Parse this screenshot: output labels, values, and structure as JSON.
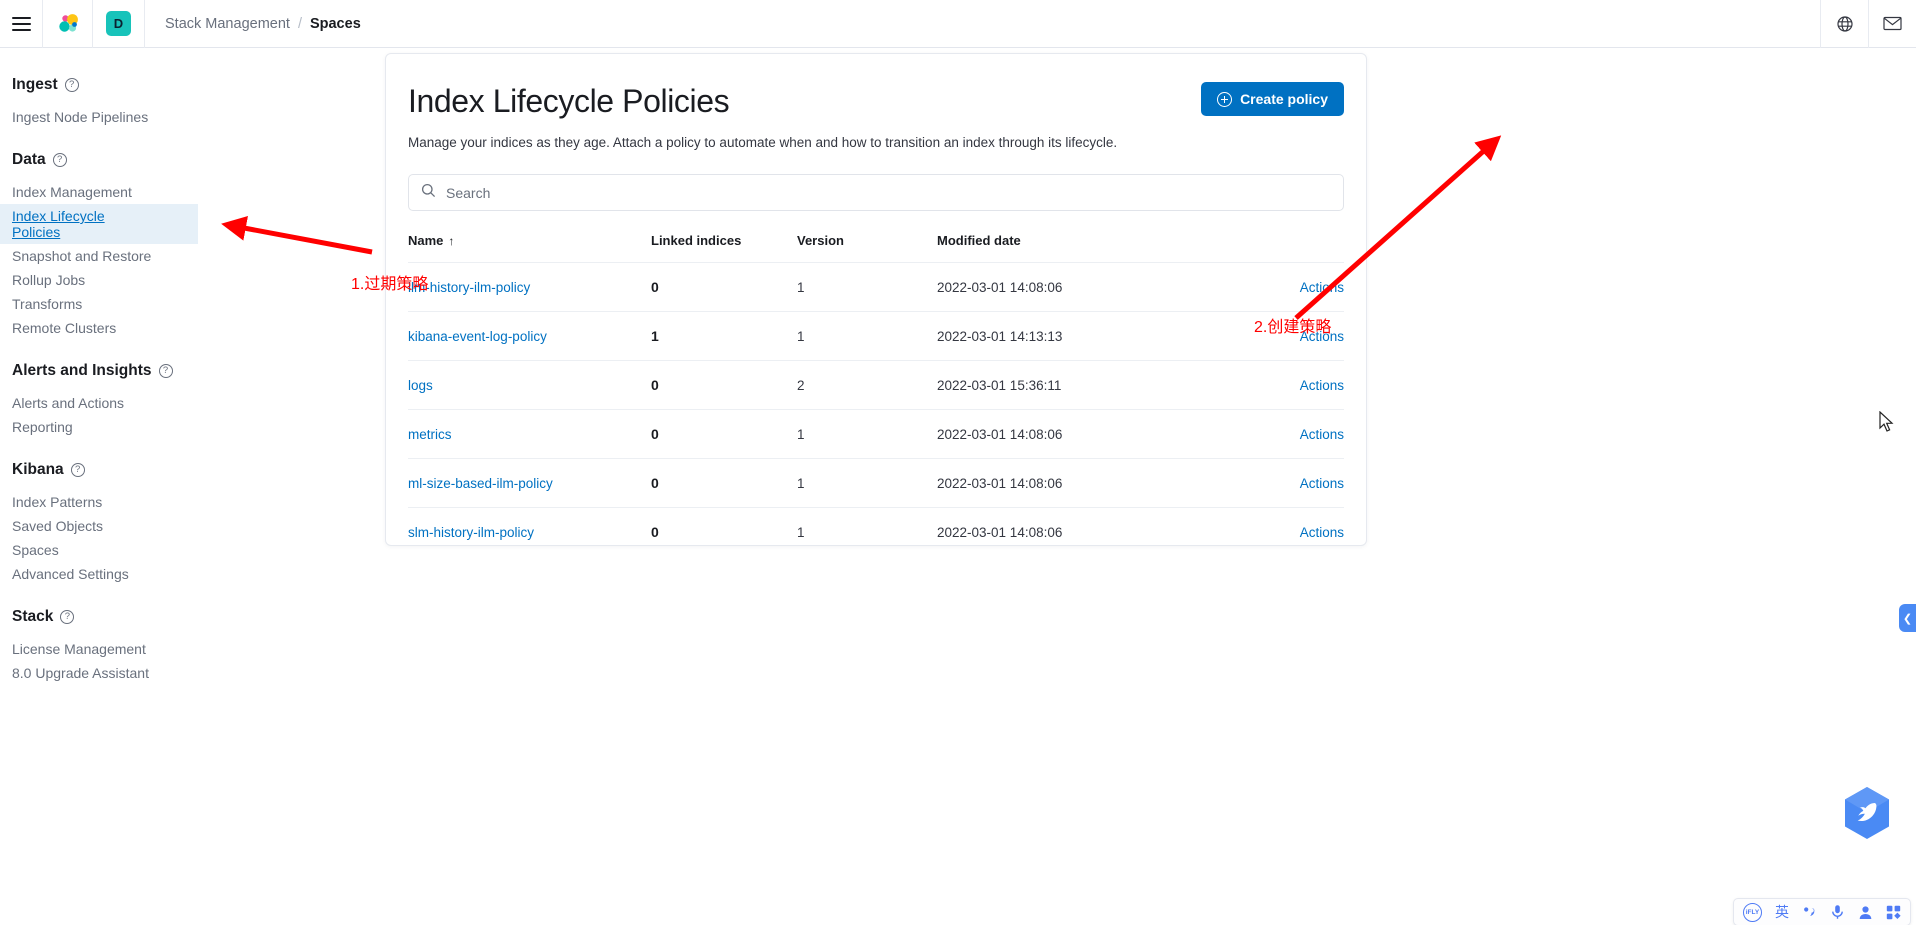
{
  "header": {
    "menu_icon": "hamburger-menu-icon",
    "logo_icon": "elastic-logo-icon",
    "space_avatar_letter": "D",
    "breadcrumbs": [
      {
        "label": "Stack Management",
        "active": false
      },
      {
        "label": "Spaces",
        "active": true
      }
    ],
    "separator": "/",
    "right_icons": [
      {
        "name": "help-globe-icon"
      },
      {
        "name": "mail-icon"
      }
    ]
  },
  "sidebar": {
    "groups": [
      {
        "title": "Ingest",
        "help_icon": "question-mark-icon",
        "items": [
          {
            "label": "Ingest Node Pipelines",
            "selected": false
          }
        ]
      },
      {
        "title": "Data",
        "help_icon": "question-mark-icon",
        "items": [
          {
            "label": "Index Management",
            "selected": false
          },
          {
            "label": "Index Lifecycle Policies",
            "selected": true
          },
          {
            "label": "Snapshot and Restore",
            "selected": false
          },
          {
            "label": "Rollup Jobs",
            "selected": false
          },
          {
            "label": "Transforms",
            "selected": false
          },
          {
            "label": "Remote Clusters",
            "selected": false
          }
        ]
      },
      {
        "title": "Alerts and Insights",
        "help_icon": "question-mark-icon",
        "items": [
          {
            "label": "Alerts and Actions",
            "selected": false
          },
          {
            "label": "Reporting",
            "selected": false
          }
        ]
      },
      {
        "title": "Kibana",
        "help_icon": "question-mark-icon",
        "items": [
          {
            "label": "Index Patterns",
            "selected": false
          },
          {
            "label": "Saved Objects",
            "selected": false
          },
          {
            "label": "Spaces",
            "selected": false
          },
          {
            "label": "Advanced Settings",
            "selected": false
          }
        ]
      },
      {
        "title": "Stack",
        "help_icon": "question-mark-icon",
        "items": [
          {
            "label": "License Management",
            "selected": false
          },
          {
            "label": "8.0 Upgrade Assistant",
            "selected": false
          }
        ]
      }
    ]
  },
  "main": {
    "title": "Index Lifecycle Policies",
    "description": "Manage your indices as they age. Attach a policy to automate when and how to transition an index through its lifecycle.",
    "create_button": {
      "label": "Create policy",
      "icon": "plus-circle-icon",
      "color": "#0071c2"
    },
    "search": {
      "placeholder": "Search",
      "value": "",
      "icon": "search-icon"
    },
    "table": {
      "columns": [
        {
          "label": "Name",
          "sorted": true,
          "sort_direction": "asc",
          "sort_glyph": "↑"
        },
        {
          "label": "Linked indices",
          "sorted": false
        },
        {
          "label": "Version",
          "sorted": false
        },
        {
          "label": "Modified date",
          "sorted": false
        },
        {
          "label": "",
          "sorted": false
        }
      ],
      "rows": [
        {
          "name": "ilm-history-ilm-policy",
          "linked_indices": "0",
          "version": "1",
          "modified_date": "2022-03-01 14:08:06",
          "actions": "Actions"
        },
        {
          "name": "kibana-event-log-policy",
          "linked_indices": "1",
          "version": "1",
          "modified_date": "2022-03-01 14:13:13",
          "actions": "Actions"
        },
        {
          "name": "logs",
          "linked_indices": "0",
          "version": "2",
          "modified_date": "2022-03-01 15:36:11",
          "actions": "Actions"
        },
        {
          "name": "metrics",
          "linked_indices": "0",
          "version": "1",
          "modified_date": "2022-03-01 14:08:06",
          "actions": "Actions"
        },
        {
          "name": "ml-size-based-ilm-policy",
          "linked_indices": "0",
          "version": "1",
          "modified_date": "2022-03-01 14:08:06",
          "actions": "Actions"
        },
        {
          "name": "slm-history-ilm-policy",
          "linked_indices": "0",
          "version": "1",
          "modified_date": "2022-03-01 14:08:06",
          "actions": "Actions"
        }
      ]
    }
  },
  "annotations": {
    "color": "#ff0000",
    "items": [
      {
        "label": "1.过期策略",
        "target": "sidebar-item-index-lifecycle-policies"
      },
      {
        "label": "2.创建策略",
        "target": "create-policy-button"
      }
    ]
  },
  "widgets": {
    "collapse_tab": {
      "icon": "chevron-left-icon",
      "color": "#4a8af4"
    },
    "bird_widget": {
      "icon": "bird-hexagon-icon",
      "color": "#4a8af4"
    },
    "ime_bar": {
      "items": [
        {
          "name": "ifly-logo-icon",
          "label": "iFLY"
        },
        {
          "name": "language-mode-toggle",
          "label": "英"
        },
        {
          "name": "punctuation-icon",
          "label": ""
        },
        {
          "name": "microphone-icon",
          "label": ""
        },
        {
          "name": "user-icon",
          "label": ""
        },
        {
          "name": "apps-grid-icon",
          "label": ""
        }
      ]
    }
  }
}
